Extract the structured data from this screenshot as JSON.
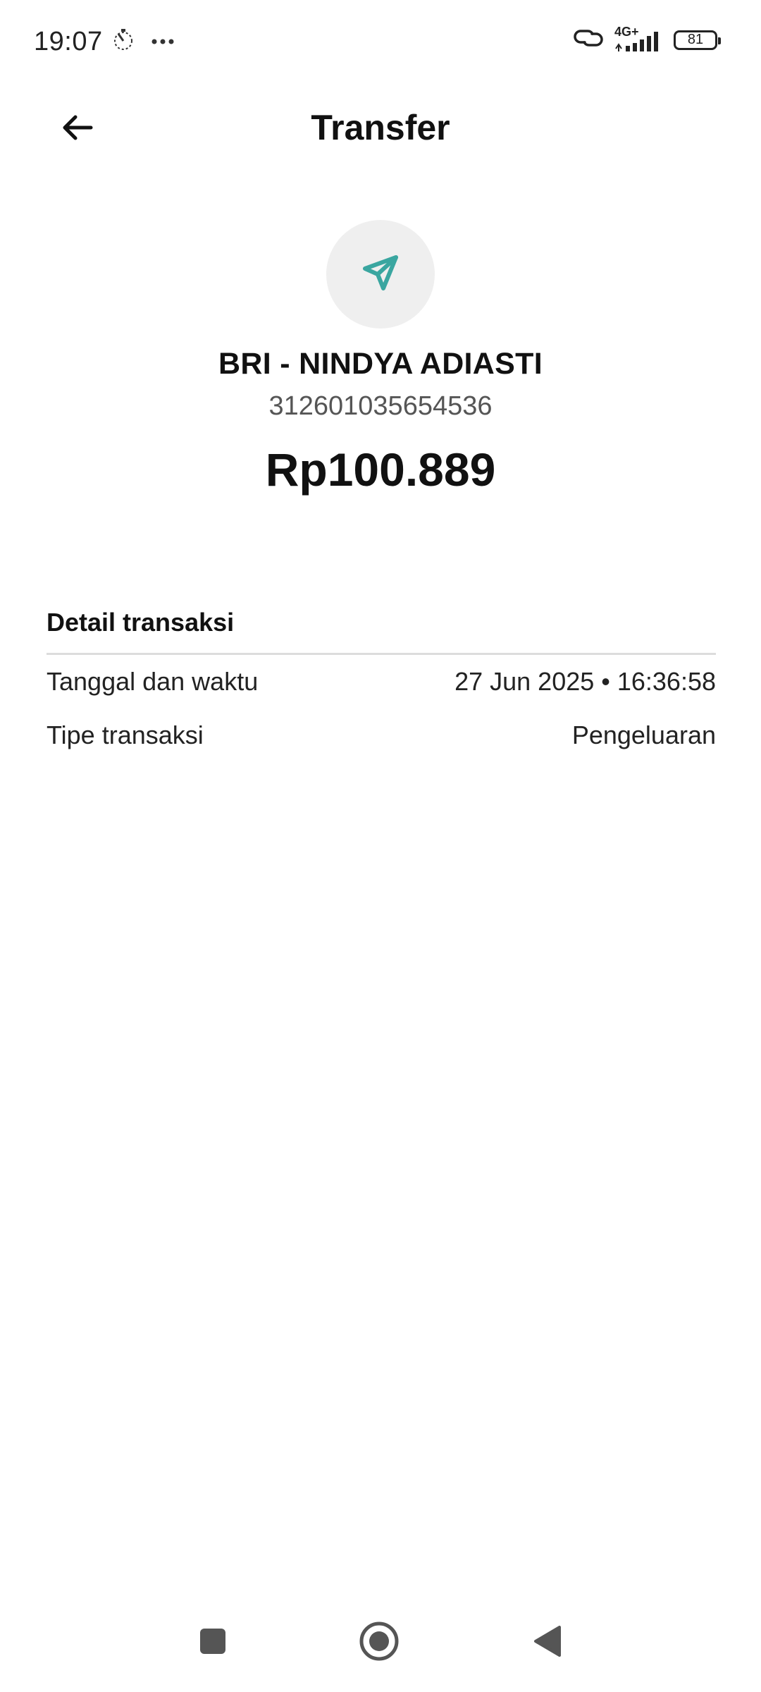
{
  "status_bar": {
    "time": "19:07",
    "network": "4G+",
    "battery": "81",
    "icons": [
      "stopwatch-icon",
      "more-dots-icon",
      "link-icon",
      "signal-icon",
      "battery-icon"
    ]
  },
  "header": {
    "title": "Transfer",
    "back_icon": "arrow-left-icon"
  },
  "transaction": {
    "icon": "paper-plane-icon",
    "recipient": "BRI - NINDYA ADIASTI",
    "account_number": "312601035654536",
    "amount": "Rp100.889"
  },
  "details": {
    "title": "Detail transaksi",
    "rows": [
      {
        "label": "Tanggal dan waktu",
        "value": "27 Jun 2025 • 16:36:58"
      },
      {
        "label": "Tipe transaksi",
        "value": "Pengeluaran"
      }
    ]
  },
  "colors": {
    "accent": "#3aa6a0",
    "icon_bg": "#efefef",
    "divider": "#dcdcdc"
  },
  "nav_bar": {
    "icons": [
      "recents-square-icon",
      "home-circle-icon",
      "back-triangle-icon"
    ]
  }
}
